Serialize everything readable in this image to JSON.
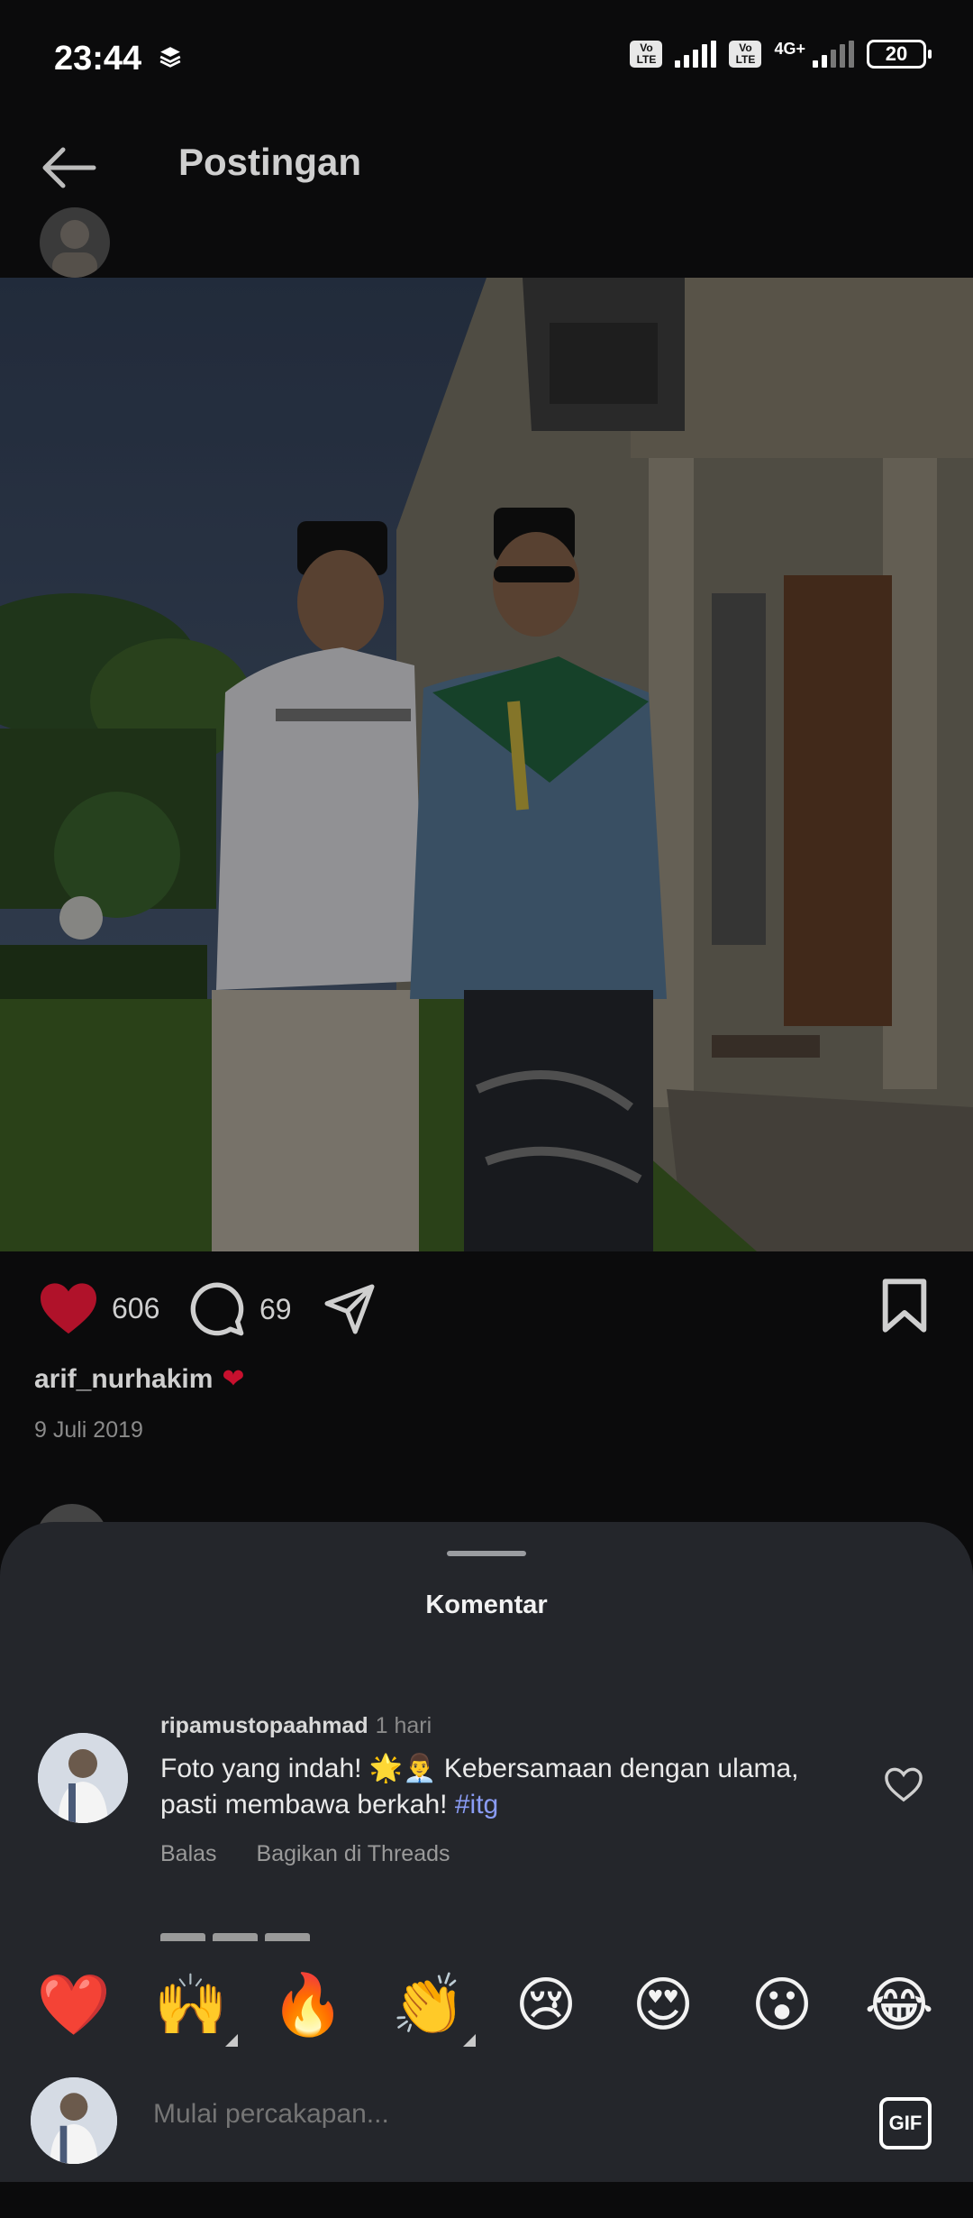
{
  "status_bar": {
    "time": "23:44",
    "volte1": "Vo LTE",
    "volte2": "Vo LTE",
    "network": "4G+",
    "battery": "20"
  },
  "header": {
    "title": "Postingan",
    "back_icon": "arrow-left-icon"
  },
  "post": {
    "likes": "606",
    "comments": "69",
    "caption_user": "arif_nurhakim",
    "caption_emoji": "❤",
    "date": "9 Juli 2019",
    "icons": {
      "like": "heart-filled-icon",
      "comment": "comment-bubble-icon",
      "share": "send-icon",
      "save": "bookmark-icon"
    },
    "colors": {
      "like": "#c8102e"
    }
  },
  "sheet": {
    "title": "Komentar",
    "comment": {
      "user": "ripamustopaahmad",
      "time": "1 hari",
      "text_main": "Foto yang indah! 🌟👨‍💼 Kebersamaan dengan ulama, pasti membawa berkah!",
      "hashtag": "#itg",
      "reply": "Balas",
      "share_threads": "Bagikan di Threads"
    },
    "emojis": [
      "❤️",
      "🙌",
      "🔥",
      "👏",
      "😢",
      "😍",
      "😮",
      "😂"
    ],
    "composer": {
      "placeholder": "Mulai percakapan...",
      "gif_label": "GIF"
    },
    "colors": {
      "sheet_bg": "#24262b",
      "hashtag": "#8a9cf5"
    }
  }
}
